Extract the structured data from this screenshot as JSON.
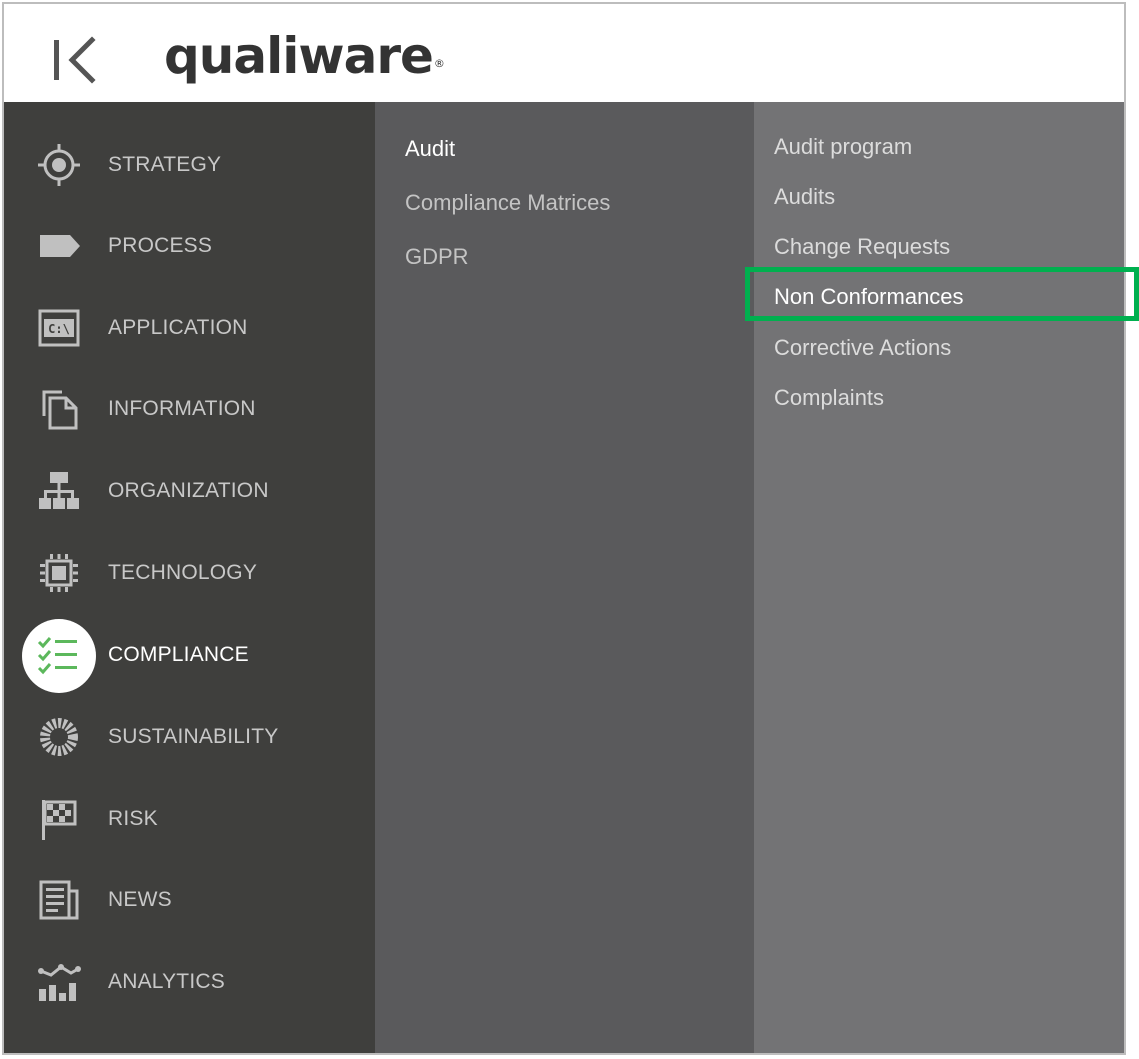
{
  "header": {
    "logo_text": "qualiware",
    "logo_mark": "®",
    "collapse_icon": "collapse-left-icon"
  },
  "colors": {
    "sidebar_bg": "#3f3f3d",
    "submenu_bg": "#5a5a5c",
    "submenu2_bg": "#737375",
    "accent_green": "#5cb85c",
    "highlight_box": "#00b04f"
  },
  "sidebar": {
    "items": [
      {
        "label": "STRATEGY",
        "icon": "target-icon"
      },
      {
        "label": "PROCESS",
        "icon": "tag-icon"
      },
      {
        "label": "APPLICATION",
        "icon": "terminal-icon"
      },
      {
        "label": "INFORMATION",
        "icon": "documents-icon"
      },
      {
        "label": "ORGANIZATION",
        "icon": "org-chart-icon"
      },
      {
        "label": "TECHNOLOGY",
        "icon": "chip-icon"
      },
      {
        "label": "COMPLIANCE",
        "icon": "checklist-icon",
        "active": true
      },
      {
        "label": "SUSTAINABILITY",
        "icon": "ring-icon"
      },
      {
        "label": "RISK",
        "icon": "flag-icon"
      },
      {
        "label": "NEWS",
        "icon": "newspaper-icon"
      },
      {
        "label": "ANALYTICS",
        "icon": "analytics-icon"
      }
    ]
  },
  "submenu": {
    "items": [
      {
        "label": "Audit",
        "selected": true
      },
      {
        "label": "Compliance Matrices"
      },
      {
        "label": "GDPR"
      }
    ]
  },
  "submenu2": {
    "items": [
      {
        "label": "Audit program"
      },
      {
        "label": "Audits"
      },
      {
        "label": "Change Requests"
      },
      {
        "label": "Non Conformances",
        "highlighted": true
      },
      {
        "label": "Corrective Actions"
      },
      {
        "label": "Complaints"
      }
    ]
  }
}
